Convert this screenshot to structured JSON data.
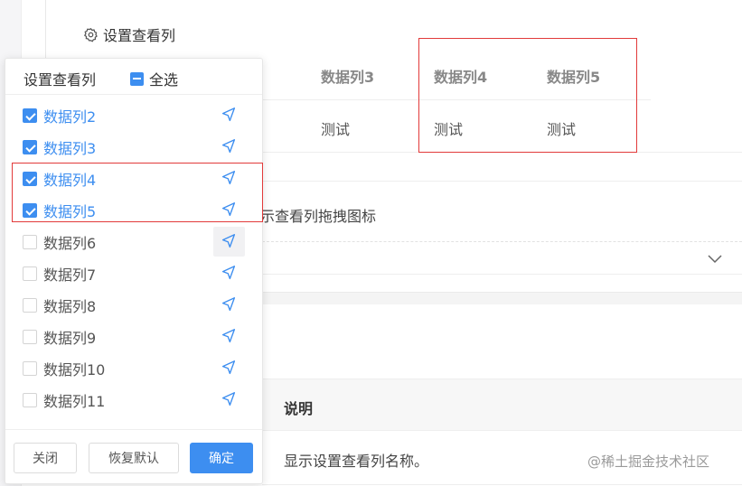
{
  "trigger": {
    "label": "设置查看列",
    "icon": "gear-icon"
  },
  "table": {
    "headers": [
      "数据列3",
      "数据列4",
      "数据列5"
    ],
    "cells": [
      "测试",
      "测试",
      "测试"
    ]
  },
  "attr_row": {
    "text": "示查看列拖拽图标"
  },
  "desc_table": {
    "header": "说明",
    "text": "显示设置查看列名称。"
  },
  "popover": {
    "title": "设置查看列",
    "select_all": "全选",
    "items": [
      {
        "label": "数据列2",
        "checked": true
      },
      {
        "label": "数据列3",
        "checked": true
      },
      {
        "label": "数据列4",
        "checked": true
      },
      {
        "label": "数据列5",
        "checked": true
      },
      {
        "label": "数据列6",
        "checked": false
      },
      {
        "label": "数据列7",
        "checked": false
      },
      {
        "label": "数据列8",
        "checked": false
      },
      {
        "label": "数据列9",
        "checked": false
      },
      {
        "label": "数据列10",
        "checked": false
      },
      {
        "label": "数据列11",
        "checked": false
      }
    ],
    "buttons": {
      "close": "关闭",
      "reset": "恢复默认",
      "ok": "确定"
    }
  },
  "watermark": "@稀土掘金技术社区",
  "colors": {
    "accent": "#3d8ef0",
    "highlight_box": "#e23a3a"
  }
}
